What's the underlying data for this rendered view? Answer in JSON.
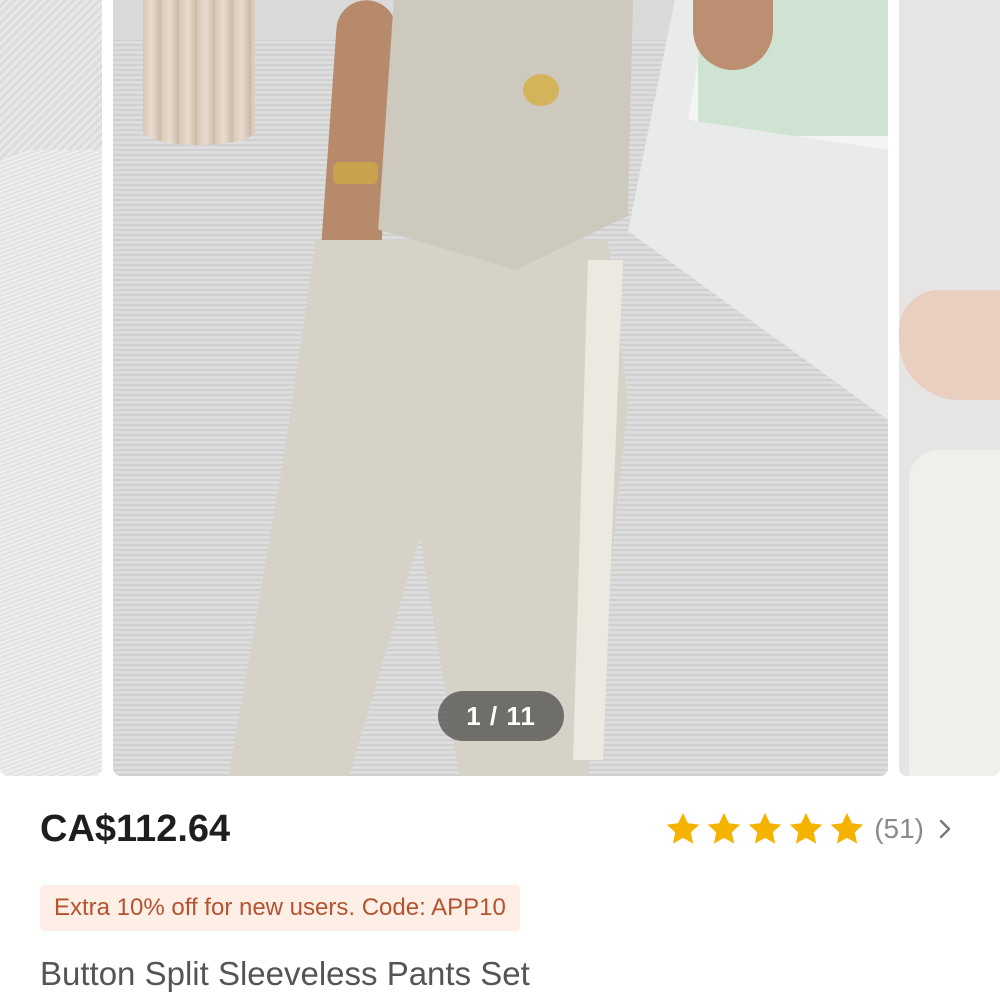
{
  "gallery": {
    "counter": "1 / 11"
  },
  "product": {
    "price": "CA$112.64",
    "rating": {
      "stars": 5,
      "review_count": "(51)"
    },
    "promo": "Extra 10% off for new users. Code: APP10",
    "title": "Button Split Sleeveless Pants Set"
  },
  "colors": {
    "star": "#f5b300",
    "promo_bg": "#fdeee6",
    "promo_text": "#b5532f",
    "counter_bg": "#4a4a4a"
  },
  "icons": {
    "star": "star-icon",
    "chevron": "chevron-right-icon"
  }
}
